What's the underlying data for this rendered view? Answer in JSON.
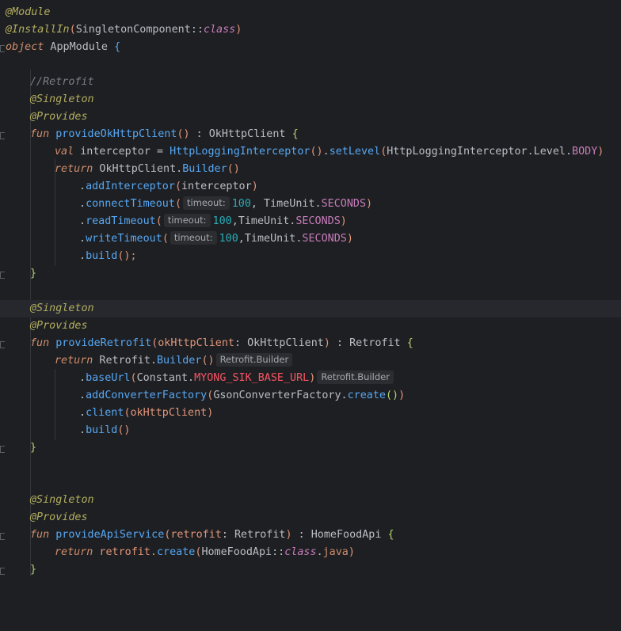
{
  "editor": {
    "l1": {
      "ann": "@Module"
    },
    "l2": {
      "ann": "@InstallIn",
      "p1": "(",
      "cls": "SingletonComponent",
      "op": "::",
      "kw": "class",
      "p2": ")"
    },
    "l3": {
      "kw": "object",
      "name": " AppModule ",
      "brace": "{"
    },
    "l5": {
      "comment": "//Retrofit"
    },
    "l6": {
      "ann": "@Singleton"
    },
    "l7": {
      "ann": "@Provides"
    },
    "l8": {
      "kw": "fun",
      "fn": " provideOkHttpClient",
      "p": "()",
      "rest": " : OkHttpClient ",
      "brace": "{"
    },
    "l9": {
      "kw": "val",
      "v": " interceptor = ",
      "cls": "HttpLoggingInterceptor",
      "p1": "()",
      "dot": ".",
      "fn": "setLevel",
      "p2": "(",
      "a": "HttpLoggingInterceptor.Level.",
      "enum": "BODY",
      "p3": ")"
    },
    "l10": {
      "kw": "return",
      "v": " OkHttpClient.",
      "fn": "Builder",
      "p": "()"
    },
    "l11": {
      "dot": ".",
      "fn": "addInterceptor",
      "p1": "(",
      "arg": "interceptor",
      "p2": ")"
    },
    "l12": {
      "dot": ".",
      "fn": "connectTimeout",
      "p1": "(",
      "hint": "timeout:",
      "num": "100",
      "sep": ", TimeUnit.",
      "enum": "SECONDS",
      "p2": ")"
    },
    "l13": {
      "dot": ".",
      "fn": "readTimeout",
      "p1": "(",
      "hint": "timeout:",
      "num": "100",
      "sep": ",TimeUnit.",
      "enum": "SECONDS",
      "p2": ")"
    },
    "l14": {
      "dot": ".",
      "fn": "writeTimeout",
      "p1": "(",
      "hint": "timeout:",
      "num": "100",
      "sep": ",TimeUnit.",
      "enum": "SECONDS",
      "p2": ")"
    },
    "l15": {
      "dot": ".",
      "fn": "build",
      "p": "()",
      "semi": ";"
    },
    "l16": {
      "brace": "}"
    },
    "l18": {
      "ann": "@Singleton"
    },
    "l19": {
      "ann": "@Provides"
    },
    "l20": {
      "kw": "fun",
      "fn": " provideRetrofit",
      "p1": "(",
      "arg": "okHttpClient",
      "rest": ": OkHttpClient",
      "p2": ")",
      "ret": " : Retrofit ",
      "brace": "{"
    },
    "l21": {
      "kw": "return",
      "v": " Retrofit.",
      "fn": "Builder",
      "p": "()",
      "hint": "Retrofit.Builder"
    },
    "l22": {
      "dot": ".",
      "fn": "baseUrl",
      "p1": "(",
      "a": "Constant.",
      "const": "MYONG_SIK_BASE_URL",
      "p2": ")",
      "hint": "Retrofit.Builder"
    },
    "l23": {
      "dot": ".",
      "fn": "addConverterFactory",
      "p1": "(",
      "a": "GsonConverterFactory.",
      "fn2": "create",
      "p2": "()",
      "p3": ")"
    },
    "l24": {
      "dot": ".",
      "fn": "client",
      "p1": "(",
      "arg": "okHttpClient",
      "p2": ")"
    },
    "l25": {
      "dot": ".",
      "fn": "build",
      "p": "()"
    },
    "l26": {
      "brace": "}"
    },
    "l29": {
      "ann": "@Singleton"
    },
    "l30": {
      "ann": "@Provides"
    },
    "l31": {
      "kw": "fun",
      "fn": " provideApiService",
      "p1": "(",
      "arg": "retrofit",
      "rest": ": Retrofit",
      "p2": ")",
      "ret": " : HomeFoodApi ",
      "brace": "{"
    },
    "l32": {
      "kw": "return",
      "v": " retrofit.",
      "fn": "create",
      "p1": "(",
      "a": "HomeFoodApi::",
      "kwc": "class",
      "dotj": ".",
      "java": "java",
      "p2": ")"
    },
    "l33": {
      "brace": "}"
    }
  }
}
